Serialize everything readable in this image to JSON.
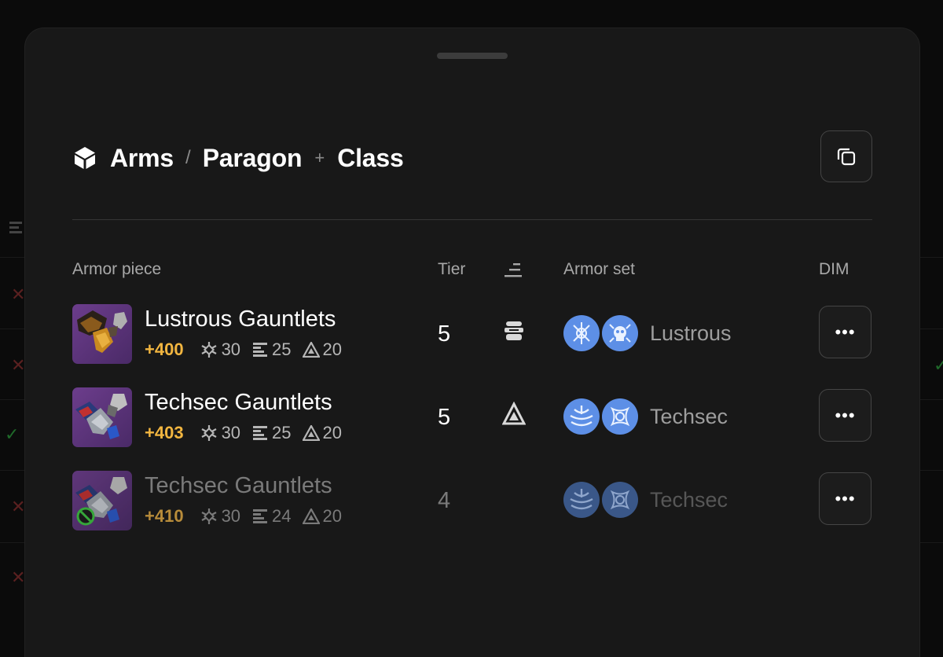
{
  "header": {
    "breadcrumb": [
      "Arms",
      "Paragon",
      "Class"
    ],
    "separator": "/",
    "plus": "+"
  },
  "columns": {
    "armor_piece": "Armor piece",
    "tier": "Tier",
    "armor_set": "Armor set",
    "dim": "DIM"
  },
  "rows": [
    {
      "name": "Lustrous Gauntlets",
      "power": "+400",
      "stats": [
        "30",
        "25",
        "20"
      ],
      "tier": "5",
      "archetype_icon": "paragon-icon",
      "set_name": "Lustrous",
      "dim_label": "•••"
    },
    {
      "name": "Techsec Gauntlets",
      "power": "+403",
      "stats": [
        "30",
        "25",
        "20"
      ],
      "tier": "5",
      "archetype_icon": "class-icon",
      "set_name": "Techsec",
      "dim_label": "•••"
    },
    {
      "name": "Techsec Gauntlets",
      "power": "+410",
      "stats": [
        "30",
        "24",
        "20"
      ],
      "tier": "4",
      "archetype_icon": "",
      "set_name": "Techsec",
      "dim_label": "•••"
    }
  ],
  "colors": {
    "power": "#f2b640",
    "set_icon": "#5d8fe6",
    "sheet": "#181818"
  }
}
